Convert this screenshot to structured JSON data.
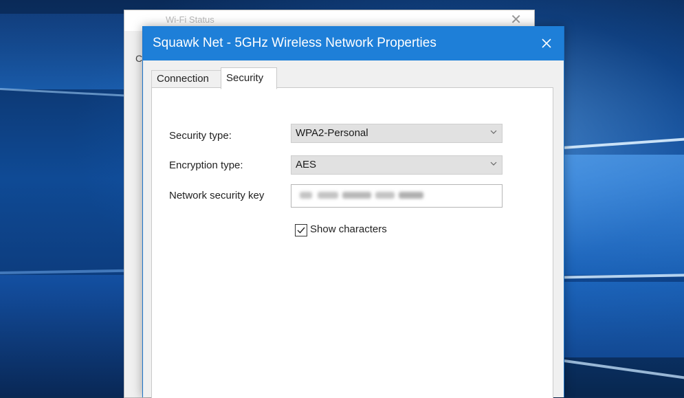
{
  "background_window": {
    "title": "Wi-Fi Status",
    "edge_letter": "C",
    "close_glyph": "✕"
  },
  "dialog": {
    "title": "Squawk Net - 5GHz Wireless Network Properties",
    "accent_color": "#1e7fd8",
    "close_icon": "close-icon",
    "tabs": [
      {
        "label": "Connection",
        "selected": false
      },
      {
        "label": "Security",
        "selected": true
      }
    ],
    "security": {
      "security_type_label": "Security type:",
      "security_type_value": "WPA2-Personal",
      "encryption_type_label": "Encryption type:",
      "encryption_type_value": "AES",
      "network_key_label": "Network security key",
      "show_characters_label": "Show characters",
      "show_characters_checked": true
    }
  }
}
